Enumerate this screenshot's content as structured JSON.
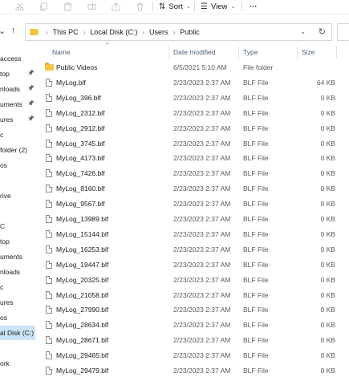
{
  "toolbar": {
    "cut_icon": "scissors-icon",
    "copy_icon": "copy-icon",
    "paste_icon": "paste-icon",
    "rename_icon": "rename-icon",
    "share_icon": "share-icon",
    "delete_icon": "trash-icon",
    "sort_label": "Sort",
    "view_label": "View",
    "more_label": "···"
  },
  "address": {
    "crumbs": [
      "This PC",
      "Local Disk (C:)",
      "Users",
      "Public"
    ]
  },
  "nav": {
    "items": [
      {
        "label": "access",
        "pinned": false
      },
      {
        "label": "top",
        "pinned": true
      },
      {
        "label": "nloads",
        "pinned": true
      },
      {
        "label": "uments",
        "pinned": true
      },
      {
        "label": "ures",
        "pinned": true
      },
      {
        "label": "c",
        "pinned": false
      },
      {
        "label": " folder (2)",
        "pinned": false
      },
      {
        "label": "os",
        "pinned": false
      },
      {
        "label": "",
        "pinned": false
      },
      {
        "label": "rive",
        "pinned": false
      },
      {
        "label": "",
        "pinned": false
      },
      {
        "label": "C",
        "pinned": false
      },
      {
        "label": "top",
        "pinned": false
      },
      {
        "label": "uments",
        "pinned": false
      },
      {
        "label": "nloads",
        "pinned": false
      },
      {
        "label": "c",
        "pinned": false
      },
      {
        "label": "ures",
        "pinned": false
      },
      {
        "label": "os",
        "pinned": false
      },
      {
        "label": "al Disk (C:)",
        "pinned": false,
        "selected": true
      },
      {
        "label": "",
        "pinned": false
      },
      {
        "label": "ork",
        "pinned": false
      }
    ]
  },
  "columns": {
    "name": "Name",
    "date": "Date modified",
    "type": "Type",
    "size": "Size"
  },
  "files": [
    {
      "name": "Public Videos",
      "date": "6/5/2021 5:10 AM",
      "type": "File folder",
      "size": "",
      "kind": "folder"
    },
    {
      "name": "MyLog.blf",
      "date": "2/23/2023 2:37 AM",
      "type": "BLF File",
      "size": "64 KB",
      "kind": "file"
    },
    {
      "name": "MyLog_396.blf",
      "date": "2/23/2023 2:37 AM",
      "type": "BLF File",
      "size": "0 KB",
      "kind": "file"
    },
    {
      "name": "MyLog_2312.blf",
      "date": "2/23/2023 2:37 AM",
      "type": "BLF File",
      "size": "0 KB",
      "kind": "file"
    },
    {
      "name": "MyLog_2912.blf",
      "date": "2/23/2023 2:37 AM",
      "type": "BLF File",
      "size": "0 KB",
      "kind": "file"
    },
    {
      "name": "MyLog_3745.blf",
      "date": "2/23/2023 2:37 AM",
      "type": "BLF File",
      "size": "0 KB",
      "kind": "file"
    },
    {
      "name": "MyLog_4173.blf",
      "date": "2/23/2023 2:37 AM",
      "type": "BLF File",
      "size": "0 KB",
      "kind": "file"
    },
    {
      "name": "MyLog_7426.blf",
      "date": "2/23/2023 2:37 AM",
      "type": "BLF File",
      "size": "0 KB",
      "kind": "file"
    },
    {
      "name": "MyLog_8160.blf",
      "date": "2/23/2023 2:37 AM",
      "type": "BLF File",
      "size": "0 KB",
      "kind": "file"
    },
    {
      "name": "MyLog_9567.blf",
      "date": "2/23/2023 2:37 AM",
      "type": "BLF File",
      "size": "0 KB",
      "kind": "file"
    },
    {
      "name": "MyLog_13989.blf",
      "date": "2/23/2023 2:37 AM",
      "type": "BLF File",
      "size": "0 KB",
      "kind": "file"
    },
    {
      "name": "MyLog_15144.blf",
      "date": "2/23/2023 2:37 AM",
      "type": "BLF File",
      "size": "0 KB",
      "kind": "file"
    },
    {
      "name": "MyLog_16253.blf",
      "date": "2/23/2023 2:37 AM",
      "type": "BLF File",
      "size": "0 KB",
      "kind": "file"
    },
    {
      "name": "MyLog_19447.blf",
      "date": "2/23/2023 2:37 AM",
      "type": "BLF File",
      "size": "0 KB",
      "kind": "file"
    },
    {
      "name": "MyLog_20325.blf",
      "date": "2/23/2023 2:37 AM",
      "type": "BLF File",
      "size": "0 KB",
      "kind": "file"
    },
    {
      "name": "MyLog_21058.blf",
      "date": "2/23/2023 2:37 AM",
      "type": "BLF File",
      "size": "0 KB",
      "kind": "file"
    },
    {
      "name": "MyLog_27990.blf",
      "date": "2/23/2023 2:37 AM",
      "type": "BLF File",
      "size": "0 KB",
      "kind": "file"
    },
    {
      "name": "MyLog_28634.blf",
      "date": "2/23/2023 2:37 AM",
      "type": "BLF File",
      "size": "0 KB",
      "kind": "file"
    },
    {
      "name": "MyLog_28671.blf",
      "date": "2/23/2023 2:37 AM",
      "type": "BLF File",
      "size": "0 KB",
      "kind": "file"
    },
    {
      "name": "MyLog_29465.blf",
      "date": "2/23/2023 2:37 AM",
      "type": "BLF File",
      "size": "0 KB",
      "kind": "file"
    },
    {
      "name": "MyLog_29479.blf",
      "date": "2/23/2023 2:37 AM",
      "type": "BLF File",
      "size": "0 KB",
      "kind": "file"
    }
  ]
}
